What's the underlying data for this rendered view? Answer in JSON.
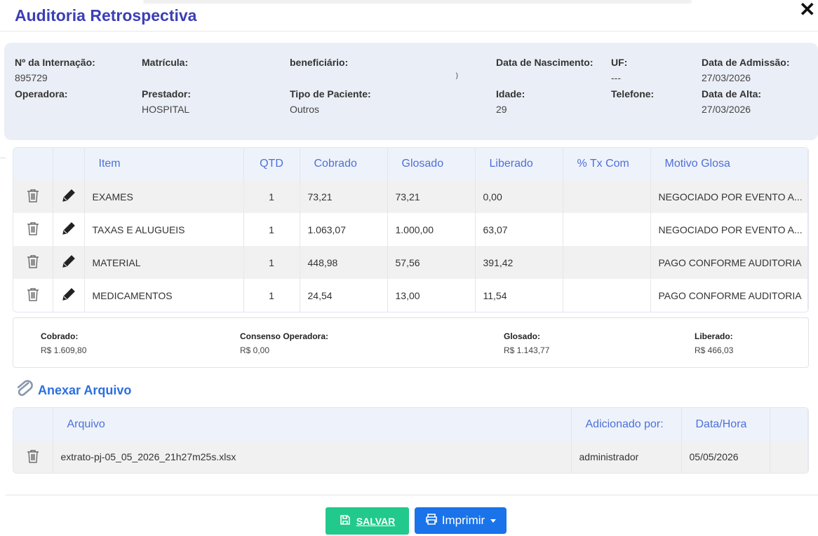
{
  "modal": {
    "title": "Auditoria Retrospectiva",
    "close_symbol": "✕"
  },
  "info": {
    "internacao_label": "Nº da Internação:",
    "internacao_value": "895729",
    "matricula_label": "Matrícula:",
    "matricula_value": "",
    "beneficiario_label": "beneficiário:",
    "beneficiario_value": ")",
    "nascimento_label": "Data de Nascimento:",
    "nascimento_value": "",
    "uf_label": "UF:",
    "uf_value": "---",
    "admissao_label": "Data de Admissão:",
    "admissao_value": "27/03/2026",
    "operadora_label": "Operadora:",
    "operadora_value": "",
    "prestador_label": "Prestador:",
    "prestador_value": "HOSPITAL",
    "tipo_label": "Tipo de Paciente:",
    "tipo_value": "Outros",
    "idade_label": "Idade:",
    "idade_value": "29",
    "telefone_label": "Telefone:",
    "telefone_value": "",
    "alta_label": "Data de Alta:",
    "alta_value": "27/03/2026"
  },
  "items_table": {
    "headers": {
      "item": "Item",
      "qtd": "QTD",
      "cobrado": "Cobrado",
      "glosado": "Glosado",
      "liberado": "Liberado",
      "tx": "% Tx Com",
      "motivo": "Motivo Glosa"
    },
    "rows": [
      {
        "item": "EXAMES",
        "qtd": "1",
        "cobrado": "73,21",
        "glosado": "73,21",
        "liberado": "0,00",
        "tx": "",
        "motivo": "NEGOCIADO POR EVENTO A..."
      },
      {
        "item": "TAXAS E ALUGUEIS",
        "qtd": "1",
        "cobrado": "1.063,07",
        "glosado": "1.000,00",
        "liberado": "63,07",
        "tx": "",
        "motivo": "NEGOCIADO POR EVENTO A..."
      },
      {
        "item": "MATERIAL",
        "qtd": "1",
        "cobrado": "448,98",
        "glosado": "57,56",
        "liberado": "391,42",
        "tx": "",
        "motivo": "PAGO CONFORME AUDITORIA"
      },
      {
        "item": "MEDICAMENTOS",
        "qtd": "1",
        "cobrado": "24,54",
        "glosado": "13,00",
        "liberado": "11,54",
        "tx": "",
        "motivo": "PAGO CONFORME AUDITORIA"
      }
    ]
  },
  "totals": {
    "cobrado_label": "Cobrado:",
    "cobrado_value": "R$ 1.609,80",
    "consenso_label": "Consenso Operadora:",
    "consenso_value": "R$ 0,00",
    "glosado_label": "Glosado:",
    "glosado_value": "R$ 1.143,77",
    "liberado_label": "Liberado:",
    "liberado_value": "R$ 466,03"
  },
  "anexar": {
    "label": "Anexar Arquivo"
  },
  "files_table": {
    "headers": {
      "arquivo": "Arquivo",
      "adicionado": "Adicionado por:",
      "data": "Data/Hora"
    },
    "rows": [
      {
        "arquivo": "extrato-pj-05_05_2026_21h27m25s.xlsx",
        "adicionado": "administrador",
        "data": "05/05/2026"
      }
    ]
  },
  "buttons": {
    "save_label": "SALVAR",
    "print_label": "Imprimir"
  },
  "colors": {
    "title": "#3b3fb6",
    "header_text": "#4e6fd8",
    "save": "#22c98c",
    "print": "#1a73e8"
  }
}
